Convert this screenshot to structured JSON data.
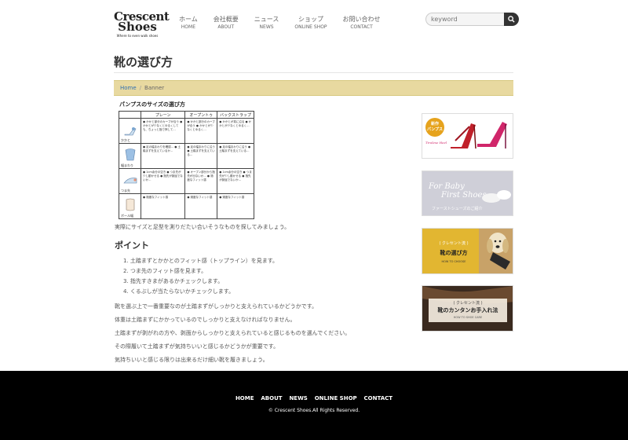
{
  "logo": {
    "line1": "Crescent",
    "line2": "Shoes",
    "tagline": "Where to even walk shoes"
  },
  "nav": [
    {
      "jp": "ホーム",
      "en": "HOME"
    },
    {
      "jp": "会社概要",
      "en": "ABOUT"
    },
    {
      "jp": "ニュース",
      "en": "NEWS"
    },
    {
      "jp": "ショップ",
      "en": "ONLINE SHOP"
    },
    {
      "jp": "お問い合わせ",
      "en": "CONTACT"
    }
  ],
  "search": {
    "placeholder": "keyword",
    "icon": "search-icon"
  },
  "page_title": "靴の選び方",
  "breadcrumb": {
    "home": "Home",
    "current": "Banner"
  },
  "size_table": {
    "title": "パンプスのサイズの選び方",
    "headers": [
      "プレーン",
      "オープントゥ",
      "バックストラップ"
    ],
    "rows": [
      {
        "label": "かかと",
        "cells": [
          "● かかと部分のカーブが合う\n● かかとが少なくとゆるくしても、ちょっと指で押して…",
          "● かかと部分のカーブが合う\n● かかとが少なくとゆるく…",
          "● かかとが真に沿る\n● かかとが少なくとゆるく…"
        ]
      },
      {
        "label": "幅まわり",
        "cells": [
          "● 足の幅まわりを確認…\n● 土踏まずを支えているか…",
          "● 足の幅まわりに沿う\n● 土踏まずを支えている…",
          "● 足の幅まわりに沿う\n● 土踏まずを支えている…"
        ]
      },
      {
        "label": "つま先",
        "cells": [
          "● 1cm余分の空き\n● つま先が少し動かせる\n● 指先が窮屈でないか…",
          "● オープン部分から指先が出ないか…\n● 適度なフィット感",
          "● 1cm余分の空き\n● つま先が少し動かせる\n● 指先が窮屈でないか…"
        ]
      },
      {
        "label": "ボール幅",
        "cells": [
          "● 適度なフィット感",
          "● 適度なフィット感",
          "● 適度なフィット感"
        ]
      }
    ]
  },
  "intro": "実際にサイズと足型を測りだたい合いそうなものを探してみましょう。",
  "point_heading": "ポイント",
  "points": [
    "1. 土踏まずとかかとのフィット感（トップライン）を見ます。",
    "2. つま先のフィット感を見ます。",
    "3. 指先すきまがあるかチェックします。",
    "4. くるぶしが当たらないかチェックします。"
  ],
  "paragraphs": [
    "靴を選ぶ上で一番重要なのが土踏まずがしっかりと支えられているかどうかです。",
    "体重は土踏まずにかかっているのでしっかりと支えなければなりません。",
    "土踏まずが剥がれの方や、剥面からしっかりと支えられていると感じるものを選んでください。",
    "その際履いて土踏まずが気持ちいいと感じるかどうかが重要です。",
    "気持ちいいと感じる限りは出来るだけ細い靴を履きましょう。"
  ],
  "banners": [
    {
      "name": "banner-new-pumps",
      "badge": "新作\nパンプス",
      "caption": "Tirolese Heel",
      "bg": "#ffffff"
    },
    {
      "name": "banner-first-shoes",
      "text1": "For Baby",
      "text2": "First Shoes",
      "caption": "ファーストシューズのご紹介",
      "bg": "#cfcfd8"
    },
    {
      "name": "banner-how-to-choose",
      "small": "( クレセント流 )",
      "title": "靴の選び方",
      "sub": "HOW TO CHOOSE",
      "bg": "#e2b631"
    },
    {
      "name": "banner-shoe-care",
      "small": "( クレセント流 )",
      "title": "靴のカンタンお手入れ法",
      "sub": "HOW TO SHOE CARE",
      "bg": "#3a2a1f"
    }
  ],
  "footer": {
    "links": [
      "HOME",
      "ABOUT",
      "NEWS",
      "ONLINE SHOP",
      "CONTACT"
    ],
    "copyright": "© Crescent Shoes.All Rights Reserved."
  }
}
